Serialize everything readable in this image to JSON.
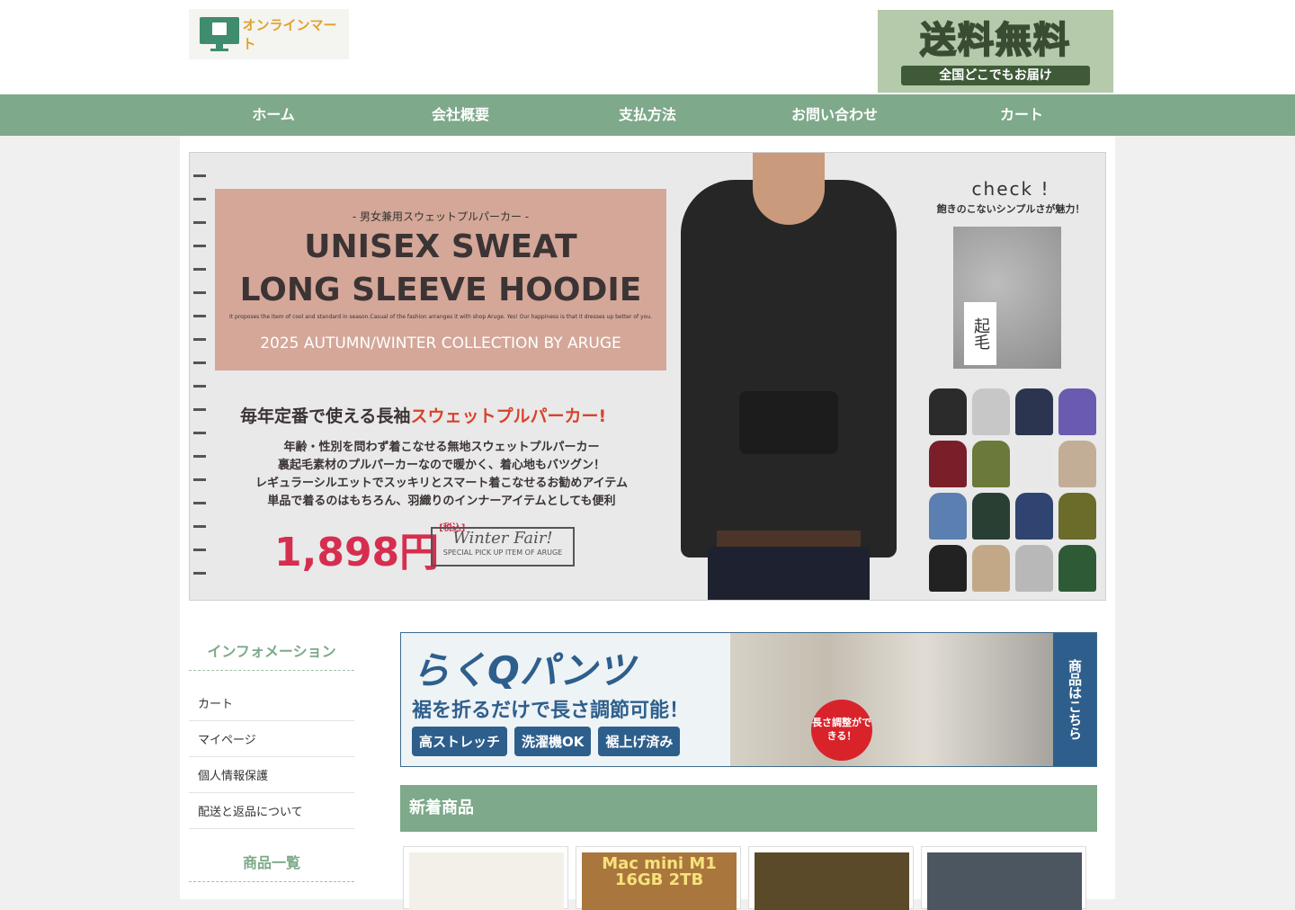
{
  "header": {
    "logo_text": "オンラインマート",
    "shipping_big": "送料無料",
    "shipping_small": "全国どこでもお届け"
  },
  "nav": [
    "ホーム",
    "会社概要",
    "支払方法",
    "お問い合わせ",
    "カート"
  ],
  "hero": {
    "sub": "- 男女兼用スウェットプルパーカー -",
    "title_line1": "UNISEX SWEAT",
    "title_line2": "LONG SLEEVE HOODIE",
    "tiny": "It proposes the item of cool and standard in season.Casual of the fashion arranges it with shop Aruge. Yes! Our happiness is that it dresses up better of you.",
    "collection": "2025 AUTUMN/WINTER COLLECTION BY ARUGE",
    "headline_prefix": "毎年定番で使える長袖",
    "headline_accent": "スウェットプルパーカー!",
    "desc1": "年齢・性別を問わず着こなせる無地スウェットプルパーカー",
    "desc2": "裏起毛素材のプルパーカーなので暖かく、着心地もバツグン！",
    "desc3": "レギュラーシルエットでスッキリとスマート着こなせるお勧めアイテム",
    "desc4": "単品で着るのはもちろん、羽織りのインナーアイテムとしても便利",
    "price": "1,898円",
    "price_tax": "[税込]",
    "fair": "Winter Fair!",
    "fair_cap": "SPECIAL PICK UP ITEM OF ARUGE",
    "check": "check !",
    "check_desc": "飽きのこないシンプルさが魅力！",
    "fabric_tag": "起毛"
  },
  "swatch_colors": [
    "#2b2b2b",
    "#c7c7c7",
    "#2c3550",
    "#6a5bb0",
    "#7a1f2a",
    "#6b7a3a",
    "#e8e8e8",
    "#c2ad96",
    "#5a7fb0",
    "#2a3f33",
    "#2f4470",
    "#6b6b2a",
    "#222222",
    "#c3a888",
    "#b8b8b8",
    "#2f5a36"
  ],
  "sidebar": {
    "info_title": "インフォメーション",
    "info_items": [
      "カート",
      "マイページ",
      "個人情報保護",
      "配送と返品について"
    ],
    "products_title": "商品一覧"
  },
  "banner": {
    "title": "らくQパンツ",
    "subtitle": "裾を折るだけで長さ調節可能！",
    "pills": [
      "高ストレッチ",
      "洗濯機OK",
      "裾上げ済み"
    ],
    "badge": "長さ調整ができる！",
    "cta": "商品はこちら"
  },
  "section": {
    "new_items": "新着商品"
  },
  "products": [
    {
      "label": ""
    },
    {
      "label": "Mac mini M1 16GB 2TB"
    },
    {
      "label": ""
    },
    {
      "label": ""
    }
  ]
}
